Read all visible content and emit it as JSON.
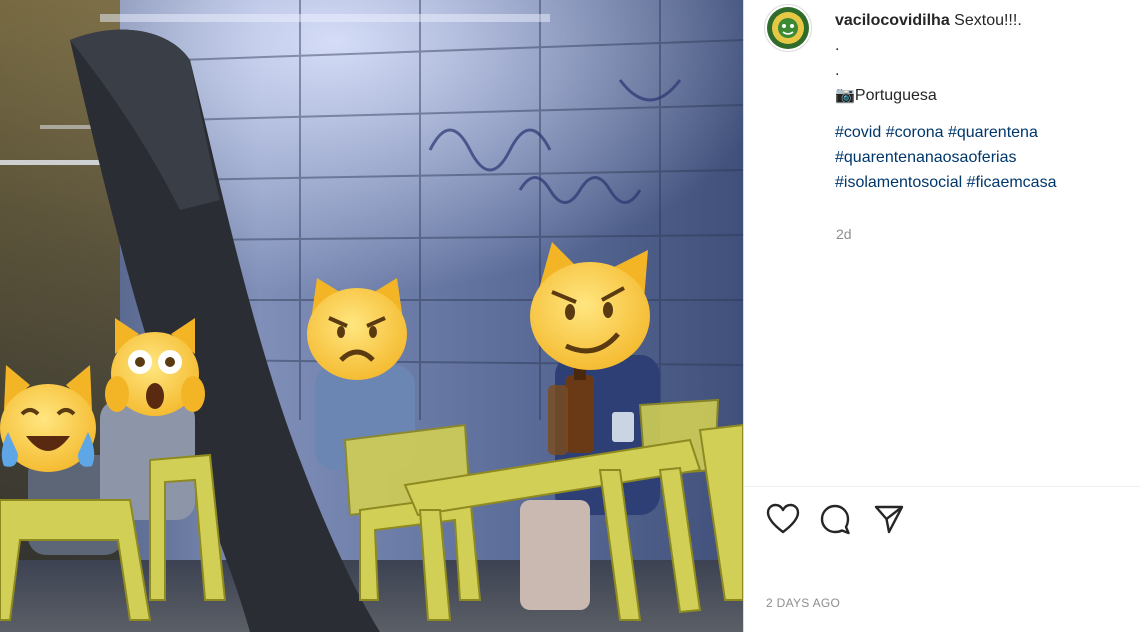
{
  "post": {
    "username": "vacilocovidilha",
    "caption_text": "Sextou!!!.",
    "dot_line_1": ".",
    "dot_line_2": ".",
    "camera_emoji": "📷",
    "location_text": "Portuguesa",
    "hashtags": [
      "#covid",
      "#corona",
      "#quarentena",
      "#quarentenanaosaoferias",
      "#isolamentosocial",
      "#ficaemcasa"
    ],
    "relative_time": "2d",
    "posted_label": "2 DAYS AGO"
  },
  "icons": {
    "like": "heart-icon",
    "comment": "comment-bubble-icon",
    "share": "paper-plane-icon",
    "avatar": "profile-avatar-icon"
  },
  "colors": {
    "hashtag": "#00376b",
    "muted": "#8e8e8e",
    "text": "#262626"
  }
}
